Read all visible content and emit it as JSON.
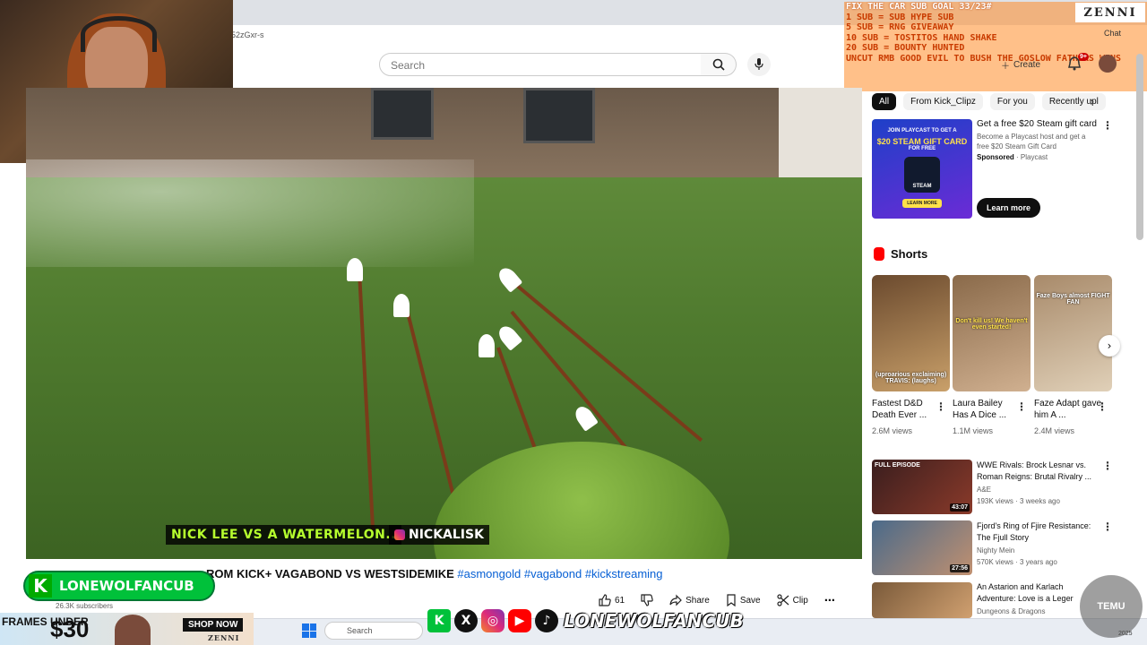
{
  "browser": {
    "address_fragment": "52zGxr-s",
    "chat_label": "Chat"
  },
  "youtube": {
    "search_placeholder": "Search",
    "create_label": "Create",
    "notification_badge": "9+",
    "video_title_prefix": "ROM KICK+ VAGABOND VS WESTSIDEMIKE",
    "hashtags": [
      "#asmongold",
      "#vagabond",
      "#kickstreaming"
    ],
    "subscribers": "26.3K subscribers",
    "likes": "61",
    "share_label": "Share",
    "save_label": "Save",
    "clip_label": "Clip"
  },
  "video": {
    "caption_left": "NICK LEE VS A WATERMELON..",
    "caption_right": "NICKALISK"
  },
  "overlay": {
    "goal_lines": [
      "FIX THE CAR SUB GOAL 33/23#",
      "1 SUB = SUB HYPE SUB",
      "5 SUB = RNG GIVEAWAY",
      "10 SUB = TOSTITOS HAND SHAKE",
      "20 SUB = BOUNTY HUNTED",
      "UNCUT RMB GOOD EVIL TO BUSH THE GOSLOW FATHERS WINS"
    ],
    "brand": "ZENNI",
    "channel_badge": "LONEWOLFANCUB",
    "social_name": "LONEWOLFANCUB",
    "temu": "TEMU"
  },
  "sidebar": {
    "chips": [
      "All",
      "From Kick_Clipz",
      "For you",
      "Recently upl"
    ],
    "ad": {
      "thumb_line1": "JOIN PLAYCAST TO GET A",
      "thumb_line2": "$20 STEAM GIFT CARD",
      "thumb_line3": "FOR FREE",
      "thumb_steam": "STEAM",
      "thumb_learn": "LEARN MORE",
      "title": "Get a free $20 Steam gift card",
      "desc": "Become a Playcast host and get a free $20 Steam Gift Card",
      "sponsored": "Sponsored",
      "advertiser": "Playcast",
      "cta": "Learn more"
    },
    "shorts_header": "Shorts",
    "shorts": [
      {
        "title": "Fastest D&D Death Ever ...",
        "views": "2.6M views",
        "overlay": "(uproarious exclaiming) TRAVIS: (laughs)",
        "color": "#6b4a2e"
      },
      {
        "title": "Laura Bailey Has A Dice ...",
        "views": "1.1M views",
        "overlay": "Don't kill us! We haven't even started!",
        "color": "#8a6a4a"
      },
      {
        "title": "Faze Adapt gave him A ...",
        "views": "2.4M views",
        "overlay": "Faze Boys almost FIGHT FAN",
        "color": "#a88a6a"
      }
    ],
    "recommended": [
      {
        "title": "WWE Rivals: Brock Lesnar vs. Roman Reigns: Brutal Rivalry ...",
        "channel": "A&E",
        "meta": "193K views · 3 weeks ago",
        "duration": "43:07",
        "badge": "FULL EPISODE",
        "color": "#3a1e1e"
      },
      {
        "title": "Fjord's Ring of Fjire Resistance: The Fjull Story",
        "channel": "Nighty Mein",
        "meta": "570K views · 3 years ago",
        "duration": "27:56",
        "badge": "",
        "color": "#4a6a8a"
      },
      {
        "title": "An Astarion and Karlach Adventure: Love is a Leger",
        "channel": "Dungeons & Dragons",
        "meta": "",
        "duration": "",
        "badge": "",
        "color": "#7a5a3a"
      }
    ]
  },
  "ad_banner": {
    "frames": "FRAMES UNDER",
    "price": "$30",
    "shop": "SHOP NOW",
    "brand": "ZENNI"
  },
  "taskbar": {
    "search_label": "Search",
    "year": "2025"
  }
}
